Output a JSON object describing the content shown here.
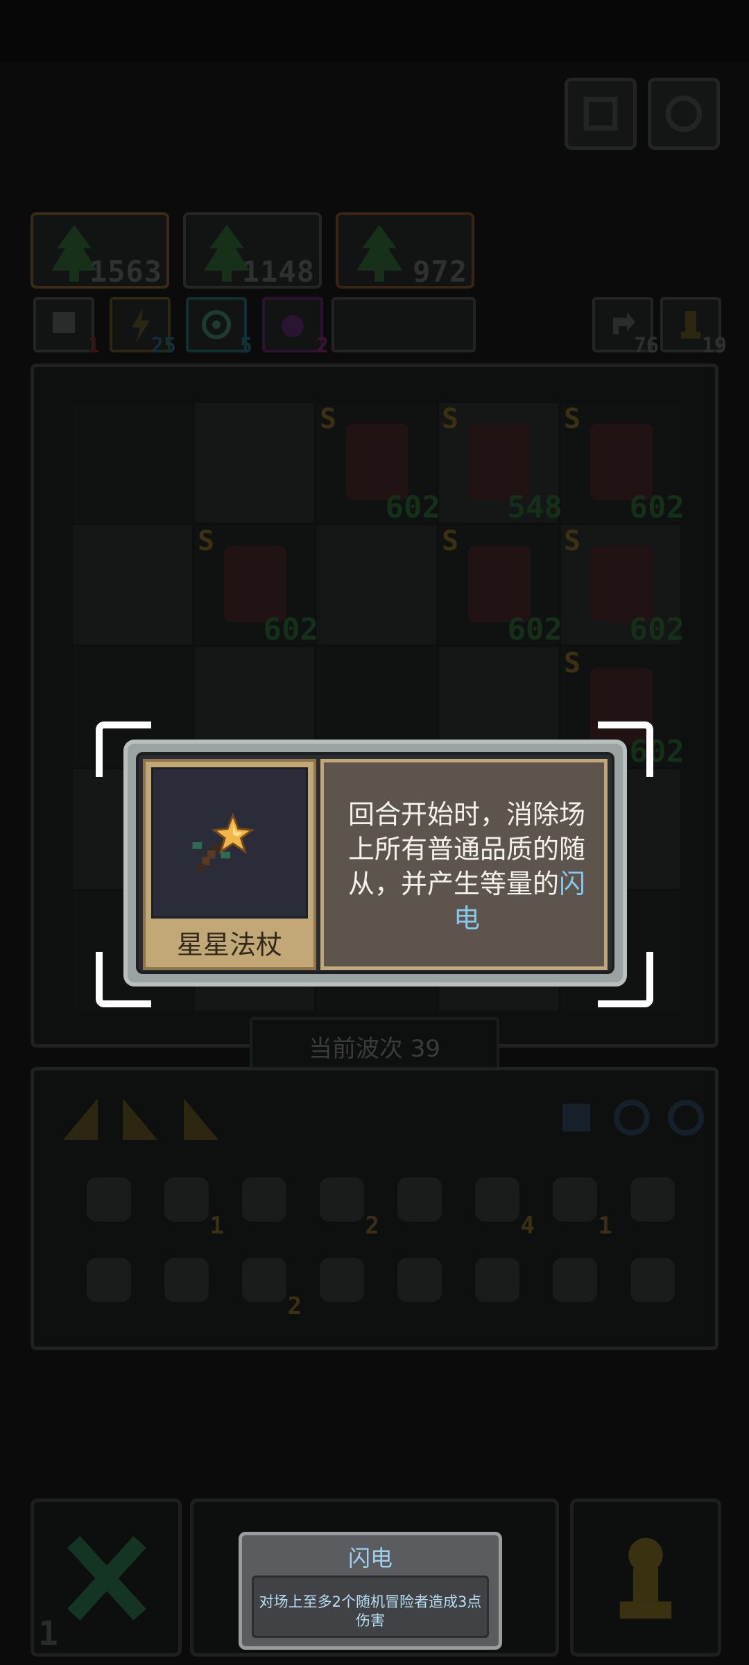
{
  "resources": {
    "cards": [
      {
        "value": "1563",
        "border": "#3a2a18"
      },
      {
        "value": "1148",
        "border": "#242726"
      },
      {
        "value": "972",
        "border": "#3a2414"
      }
    ],
    "chips": [
      {
        "icon": "skull-icon",
        "value": "1",
        "color": "#3a1414"
      },
      {
        "icon": "lightning-chip-icon",
        "value": "25",
        "color": "#123039"
      },
      {
        "icon": "target-icon",
        "value": "5",
        "color": "#123039"
      },
      {
        "icon": "potion-chip-icon",
        "value": "2",
        "color": "#3a1430"
      }
    ],
    "right_chips": [
      {
        "icon": "refresh-icon",
        "value": "76"
      },
      {
        "icon": "pawn-icon",
        "value": "19"
      }
    ]
  },
  "board": {
    "units": [
      {
        "col": 2,
        "row": 0,
        "rank": "S",
        "hp": "602"
      },
      {
        "col": 3,
        "row": 0,
        "rank": "S",
        "hp": "548"
      },
      {
        "col": 4,
        "row": 0,
        "rank": "S",
        "hp": "602"
      },
      {
        "col": 1,
        "row": 1,
        "rank": "S",
        "hp": "602"
      },
      {
        "col": 3,
        "row": 1,
        "rank": "S",
        "hp": "602"
      },
      {
        "col": 4,
        "row": 1,
        "rank": "S",
        "hp": "602"
      },
      {
        "col": 4,
        "row": 2,
        "rank": "S",
        "hp": "602"
      }
    ],
    "wave_label": "当前波次 39"
  },
  "inventory": {
    "items": [
      {
        "icon": "goo-icon",
        "count": ""
      },
      {
        "icon": "bone-icon",
        "count": "1"
      },
      {
        "icon": "shield-icon",
        "count": ""
      },
      {
        "icon": "mushroom-icon",
        "count": "2"
      },
      {
        "icon": "star-wand-icon",
        "count": ""
      },
      {
        "icon": "cloud-icon",
        "count": "4"
      },
      {
        "icon": "pickaxe-icon",
        "count": "1"
      },
      {
        "icon": "flask-icon",
        "count": ""
      },
      {
        "icon": "blue-potion-icon",
        "count": ""
      },
      {
        "icon": "orb-icon",
        "count": ""
      },
      {
        "icon": "mimic-icon",
        "count": "2"
      },
      {
        "icon": "feather-icon",
        "count": ""
      },
      {
        "icon": "green-orb-icon",
        "count": ""
      },
      {
        "icon": "syringe-icon",
        "count": ""
      },
      {
        "icon": "camera-icon",
        "count": ""
      },
      {
        "icon": "book-icon",
        "count": ""
      }
    ]
  },
  "tooltip": {
    "item_name": "星星法杖",
    "desc_part1": "回合开始时，消除场上所有普通品质的随从，并产生等量的",
    "desc_highlight": "闪电"
  },
  "lightning_tip": {
    "title": "闪电",
    "body": "对场上至多2个随机冒险者造成3点伤害"
  },
  "bottom": {
    "left_count": "1"
  }
}
